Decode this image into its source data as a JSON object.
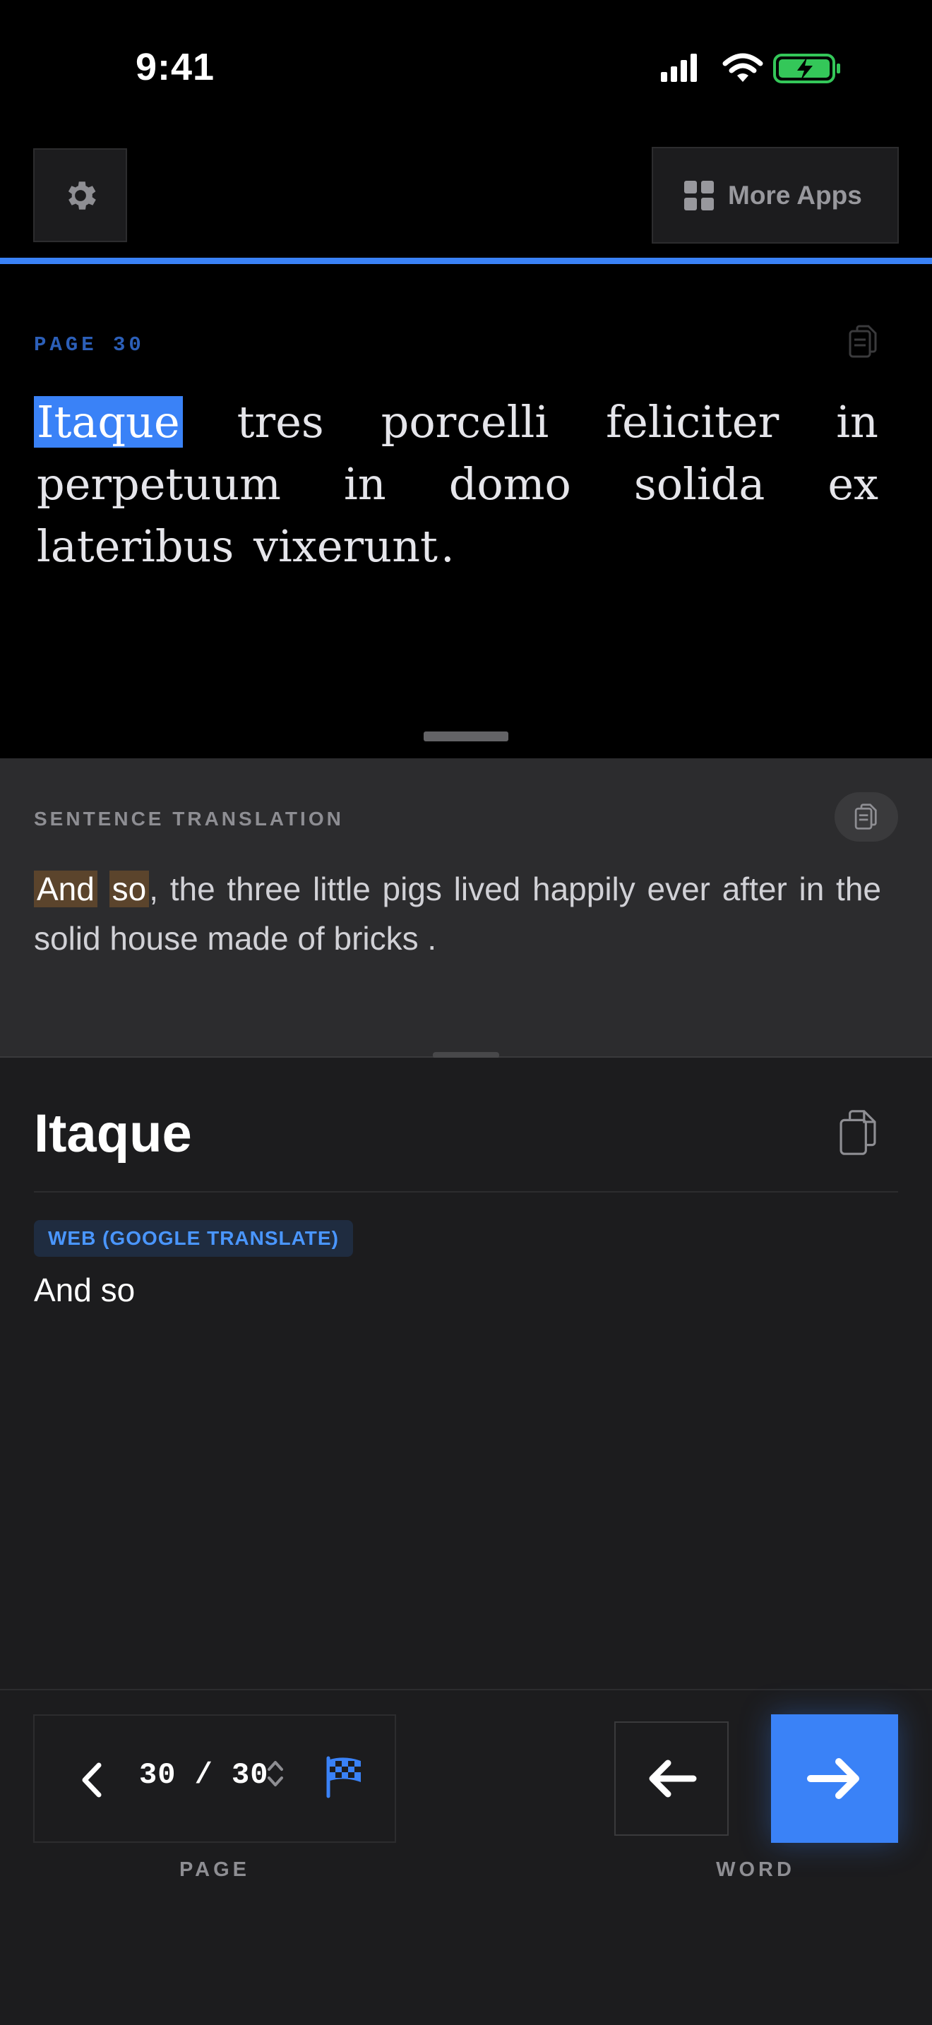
{
  "status_bar": {
    "time": "9:41"
  },
  "toolbar": {
    "more_apps_label": "More Apps",
    "settings_icon": "gear-icon",
    "more_apps_icon": "grid-icon"
  },
  "source": {
    "page_label": "PAGE 30",
    "words": [
      "Itaque",
      "tres",
      "porcelli",
      "feliciter",
      "in",
      "perpetuum",
      "in",
      "domo",
      "solida",
      "ex",
      "lateribus",
      "vixerunt"
    ],
    "end_punct": ".",
    "highlighted_word": "Itaque"
  },
  "translation": {
    "label": "SENTENCE TRANSLATION",
    "text_highlight_1": "And",
    "text_highlight_2": "so",
    "text_rest": ", the three little pigs lived happily ever after in the solid house made of bricks ."
  },
  "entry": {
    "word": "Itaque",
    "source_badge": "WEB (GOOGLE TRANSLATE)",
    "translation": "And so"
  },
  "navigation": {
    "page_counter": "30 / 30",
    "page_caption": "PAGE",
    "word_caption": "WORD"
  },
  "colors": {
    "accent": "#3a82f7",
    "highlight_translation": "#5b442c",
    "battery_green": "#34c759"
  }
}
